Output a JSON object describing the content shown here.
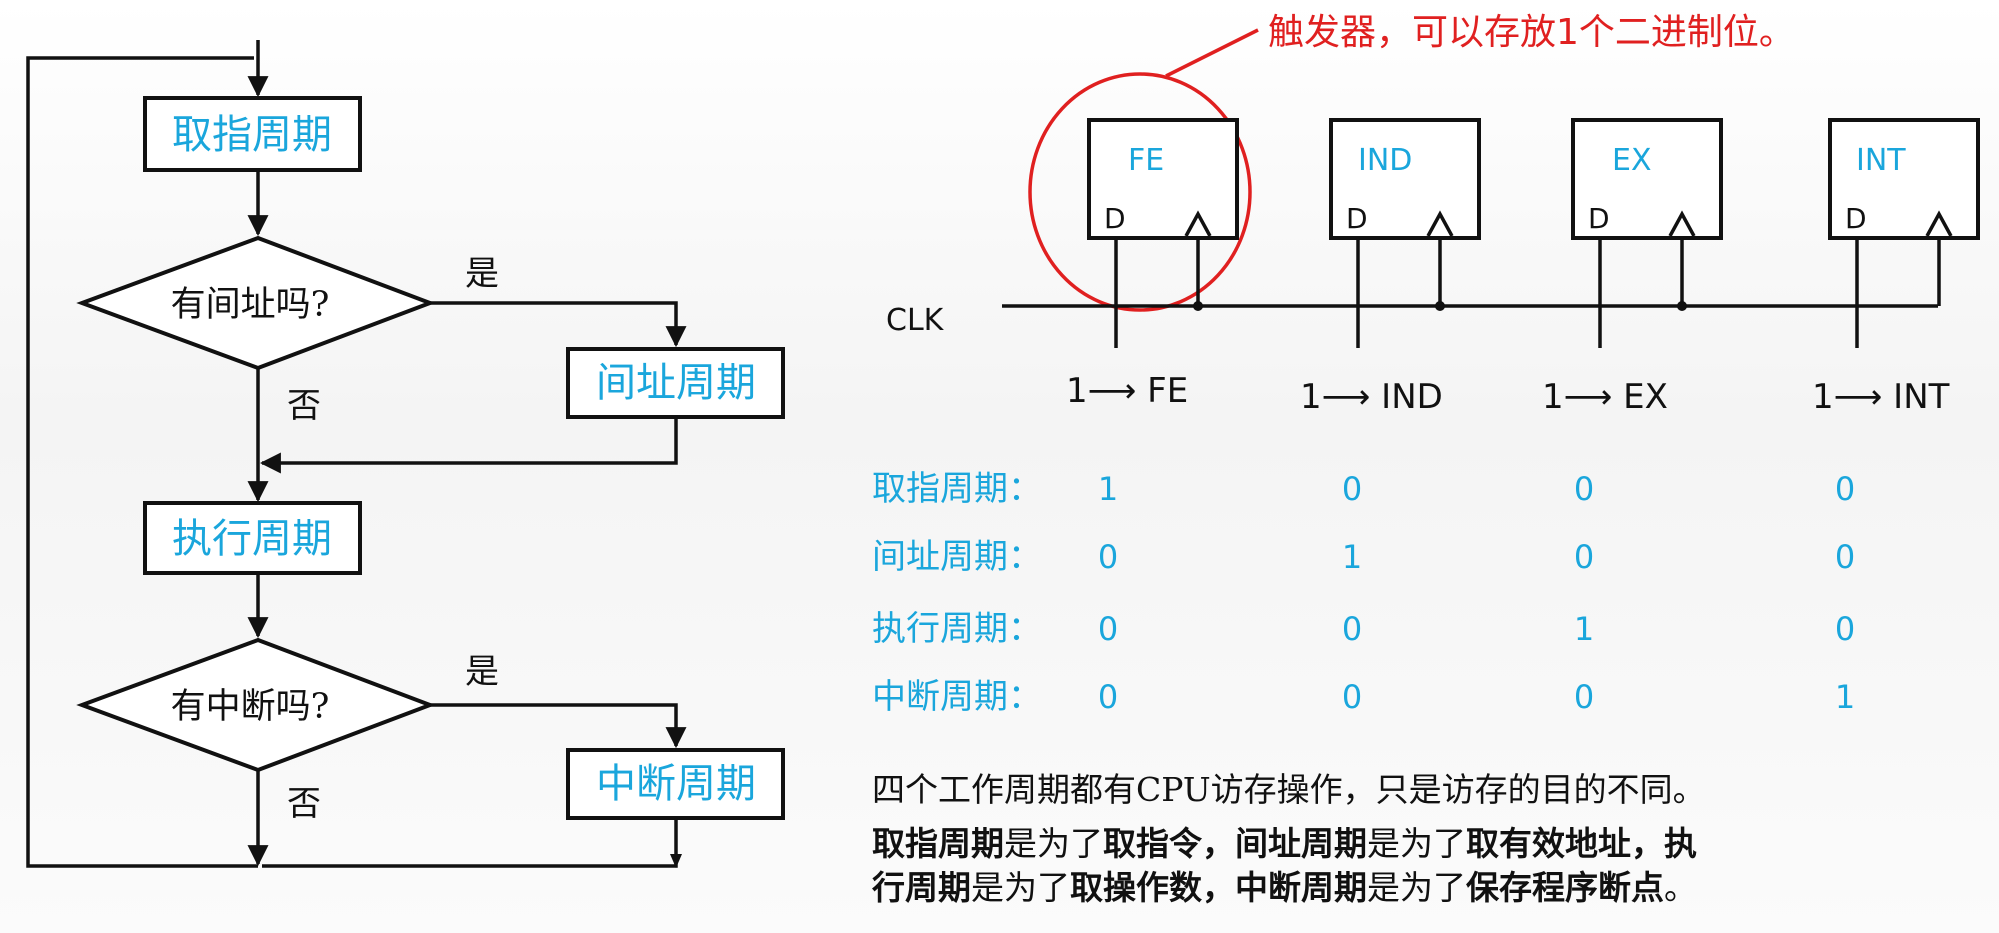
{
  "flowchart": {
    "fetch": "取指周期",
    "q_indirect": "有间址吗?",
    "yes1": "是",
    "no1": "否",
    "indirect": "间址周期",
    "execute": "执行周期",
    "q_interrupt": "有中断吗?",
    "yes2": "是",
    "no2": "否",
    "interrupt": "中断周期"
  },
  "callout": "触发器，可以存放1个二进制位。",
  "flipflops": {
    "ff1": {
      "name": "FE",
      "d": "D",
      "set": "1⟶ FE"
    },
    "ff2": {
      "name": "IND",
      "d": "D",
      "set": "1⟶ IND"
    },
    "ff3": {
      "name": "EX",
      "d": "D",
      "set": "1⟶ EX"
    },
    "ff4": {
      "name": "INT",
      "d": "D",
      "set": "1⟶ INT"
    }
  },
  "clk": "CLK",
  "table": {
    "rows": [
      {
        "label": "取指周期：",
        "values": [
          "1",
          "0",
          "0",
          "0"
        ]
      },
      {
        "label": "间址周期：",
        "values": [
          "0",
          "1",
          "0",
          "0"
        ]
      },
      {
        "label": "执行周期：",
        "values": [
          "0",
          "0",
          "1",
          "0"
        ]
      },
      {
        "label": "中断周期：",
        "values": [
          "0",
          "0",
          "0",
          "1"
        ]
      }
    ]
  },
  "description": {
    "line1": "四个工作周期都有CPU访存操作，只是访存的目的不同。",
    "line2a": "取指周期",
    "line2b": "是为了",
    "line2c": "取指令，间址周期",
    "line2d": "是为了",
    "line2e": "取有效地址，执",
    "line3a": "行周期",
    "line3b": "是为了",
    "line3c": "取操作数，中断周期",
    "line3d": "是为了",
    "line3e": "保存程序断点",
    "line3f": "。"
  }
}
